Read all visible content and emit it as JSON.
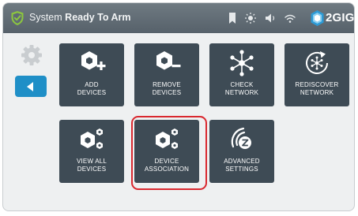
{
  "status": {
    "prefix": "System",
    "state": "Ready To Arm"
  },
  "brand": {
    "logo_text": "2GIG"
  },
  "tiles": [
    {
      "line1": "ADD",
      "line2": "DEVICES",
      "icon": "add-device-icon"
    },
    {
      "line1": "REMOVE",
      "line2": "DEVICES",
      "icon": "remove-device-icon"
    },
    {
      "line1": "CHECK",
      "line2": "NETWORK",
      "icon": "network-icon"
    },
    {
      "line1": "REDISCOVER",
      "line2": "NETWORK",
      "icon": "rediscover-network-icon"
    },
    {
      "line1": "VIEW ALL",
      "line2": "DEVICES",
      "icon": "devices-icon"
    },
    {
      "line1": "DEVICE",
      "line2": "ASSOCIATION",
      "icon": "device-association-icon"
    },
    {
      "line1": "ADVANCED",
      "line2": "SETTINGS",
      "icon": "z-wave-icon"
    }
  ],
  "highlighted_tile": "DEVICE ASSOCIATION",
  "colors": {
    "topbar": "#5f6b74",
    "tile": "#3e4b55",
    "back_button": "#1f8fc7",
    "shield": "#8cc63f",
    "highlight": "#d9282f"
  }
}
